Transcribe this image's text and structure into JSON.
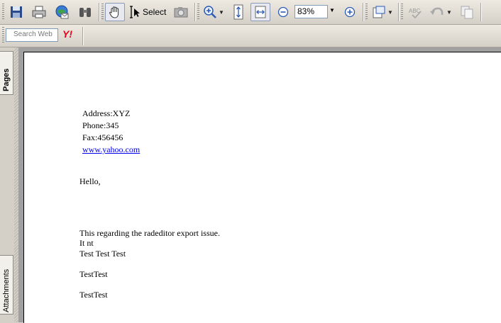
{
  "toolbar": {
    "select_label": "Select",
    "zoom_value": "83%"
  },
  "searchbar": {
    "placeholder": "Search Web",
    "logo_text": "Y!"
  },
  "nav_tabs": {
    "pages": "Pages",
    "attachments": "Attachments"
  },
  "document": {
    "address": "Address:XYZ",
    "phone": "Phone:345",
    "fax": "Fax:456456",
    "website": "www.yahoo.com",
    "greeting": "Hello,",
    "line1": "This regarding the radeditor export issue.",
    "line2": "It nt",
    "line3": "Test Test Test",
    "line4": "TestTest",
    "line5": "TestTest"
  },
  "colors": {
    "link": "#0000ee",
    "chrome": "#d4d0c8"
  }
}
